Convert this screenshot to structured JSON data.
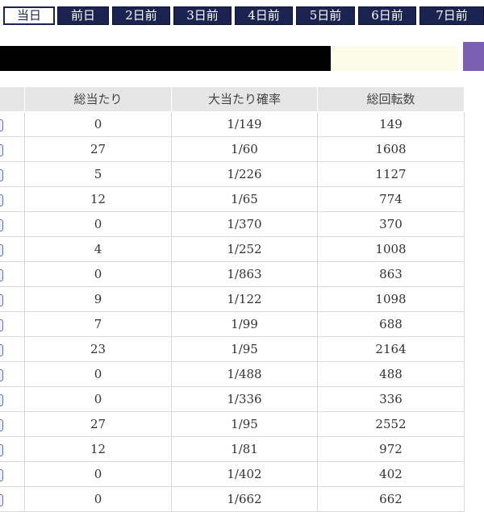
{
  "tabs": [
    {
      "label": "当日",
      "active": true
    },
    {
      "label": "前日",
      "active": false
    },
    {
      "label": "2日前",
      "active": false
    },
    {
      "label": "3日前",
      "active": false
    },
    {
      "label": "4日前",
      "active": false
    },
    {
      "label": "5日前",
      "active": false
    },
    {
      "label": "6日前",
      "active": false
    },
    {
      "label": "7日前",
      "active": false
    }
  ],
  "table": {
    "headers": [
      "総当たり",
      "大当たり確率",
      "総回転数"
    ],
    "rows": [
      {
        "total_hits": "0",
        "probability": "1/149",
        "spins": "149"
      },
      {
        "total_hits": "27",
        "probability": "1/60",
        "spins": "1608"
      },
      {
        "total_hits": "5",
        "probability": "1/226",
        "spins": "1127"
      },
      {
        "total_hits": "12",
        "probability": "1/65",
        "spins": "774"
      },
      {
        "total_hits": "0",
        "probability": "1/370",
        "spins": "370"
      },
      {
        "total_hits": "4",
        "probability": "1/252",
        "spins": "1008"
      },
      {
        "total_hits": "0",
        "probability": "1/863",
        "spins": "863"
      },
      {
        "total_hits": "9",
        "probability": "1/122",
        "spins": "1098"
      },
      {
        "total_hits": "7",
        "probability": "1/99",
        "spins": "688"
      },
      {
        "total_hits": "23",
        "probability": "1/95",
        "spins": "2164"
      },
      {
        "total_hits": "0",
        "probability": "1/488",
        "spins": "488"
      },
      {
        "total_hits": "0",
        "probability": "1/336",
        "spins": "336"
      },
      {
        "total_hits": "27",
        "probability": "1/95",
        "spins": "2552"
      },
      {
        "total_hits": "12",
        "probability": "1/81",
        "spins": "972"
      },
      {
        "total_hits": "0",
        "probability": "1/402",
        "spins": "402"
      },
      {
        "total_hits": "0",
        "probability": "1/662",
        "spins": "662"
      }
    ]
  },
  "colors": {
    "tab_bg": "#1b2350",
    "header_black": "#000000",
    "header_cream": "#fdfbe9",
    "header_purple": "#7b5fb4",
    "table_header_bg": "#e6e6e6"
  }
}
